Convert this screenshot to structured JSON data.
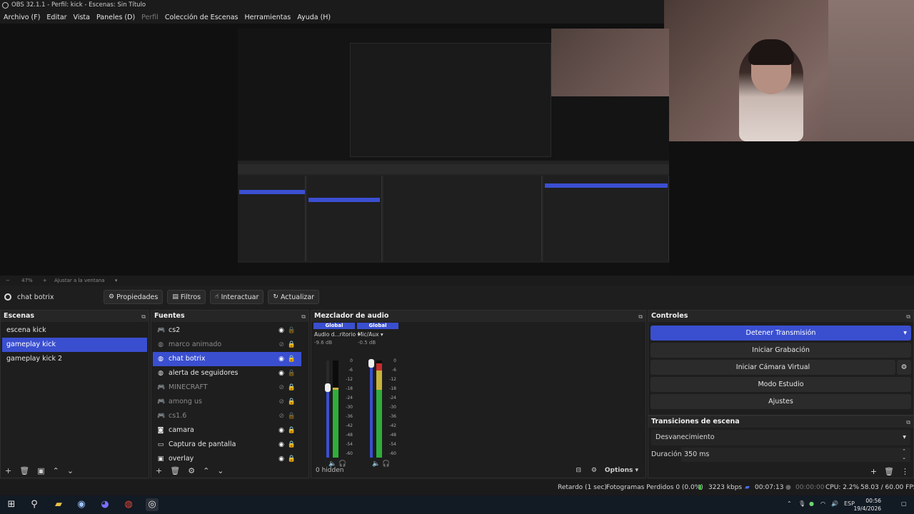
{
  "window": {
    "title": "OBS 32.1.1 - Perfil: kick - Escenas: Sin Título"
  },
  "menu": [
    {
      "label": "Archivo (F)",
      "enabled": true
    },
    {
      "label": "Editar",
      "enabled": true
    },
    {
      "label": "Vista",
      "enabled": true
    },
    {
      "label": "Paneles (D)",
      "enabled": true
    },
    {
      "label": "Perfil",
      "enabled": false
    },
    {
      "label": "Colección de Escenas",
      "enabled": true
    },
    {
      "label": "Herramientas",
      "enabled": true
    },
    {
      "label": "Ayuda (H)",
      "enabled": true
    }
  ],
  "zoom": {
    "percent": "47%",
    "fit_label": "Ajustar a la ventana"
  },
  "source_toolbar": {
    "current_source": "chat botrix",
    "properties": "Propiedades",
    "filters": "Filtros",
    "interact": "Interactuar",
    "refresh": "Actualizar"
  },
  "scenes": {
    "title": "Escenas",
    "items": [
      {
        "label": "escena kick",
        "selected": false
      },
      {
        "label": "gameplay kick",
        "selected": true
      },
      {
        "label": "gameplay kick 2",
        "selected": false
      }
    ]
  },
  "sources": {
    "title": "Fuentes",
    "items": [
      {
        "label": "cs2",
        "icon": "gamepad-icon",
        "visible": true,
        "locked": false,
        "selected": false
      },
      {
        "label": "marco animado",
        "icon": "globe-icon",
        "visible": false,
        "locked": true,
        "selected": false
      },
      {
        "label": "chat botrix",
        "icon": "globe-icon",
        "visible": true,
        "locked": true,
        "selected": true
      },
      {
        "label": "alerta de seguidores",
        "icon": "globe-icon",
        "visible": true,
        "locked": false,
        "selected": false
      },
      {
        "label": "MINECRAFT",
        "icon": "gamepad-icon",
        "visible": false,
        "locked": true,
        "selected": false
      },
      {
        "label": "among us",
        "icon": "gamepad-icon",
        "visible": false,
        "locked": true,
        "selected": false
      },
      {
        "label": "cs1.6",
        "icon": "gamepad-icon",
        "visible": false,
        "locked": false,
        "selected": false
      },
      {
        "label": "camara",
        "icon": "camera-icon",
        "visible": true,
        "locked": true,
        "selected": false
      },
      {
        "label": "Captura de pantalla",
        "icon": "monitor-icon",
        "visible": true,
        "locked": true,
        "selected": false
      },
      {
        "label": "overlay",
        "icon": "image-icon",
        "visible": true,
        "locked": true,
        "selected": false
      }
    ]
  },
  "mixer": {
    "title": "Mezclador de audio",
    "channels": [
      {
        "tag": "Global",
        "name": "Audio d...ritorio",
        "db": "-9.6 dB",
        "level": 0.72,
        "fader": 0.72
      },
      {
        "tag": "Global",
        "name": "Mic/Aux",
        "db": "-0.5 dB",
        "level": 0.97,
        "fader": 0.97
      }
    ],
    "scale": [
      "0",
      "-6",
      "-12",
      "-18",
      "-24",
      "-30",
      "-36",
      "-42",
      "-48",
      "-54",
      "-60"
    ],
    "hidden": "0 hidden",
    "options": "Options",
    "colors": {
      "green": "#2fae3a",
      "yellow": "#c9b23a",
      "red": "#c62b2b",
      "blue": "#3a4fd0"
    }
  },
  "controls": {
    "title": "Controles",
    "stop_stream": "Detener Transmisión",
    "start_recording": "Iniciar Grabación",
    "start_vcam": "Iniciar Cámara Virtual",
    "studio_mode": "Modo Estudio",
    "settings": "Ajustes"
  },
  "transitions": {
    "title": "Transiciones de escena",
    "selected": "Desvanecimiento",
    "duration_label": "Duración",
    "duration_value": "350 ms"
  },
  "status": {
    "delay": "Retardo (1 sec)",
    "dropped": "Fotogramas Perdidos 0 (0.0%)",
    "bitrate": "3223 kbps",
    "stream_time": "00:07:13",
    "rec_time": "00:00:00",
    "cpu": "CPU: 2.2%",
    "fps": "58.03 / 60.00 FPS"
  },
  "taskbar": {
    "lang": "ESP",
    "time": "00:56",
    "date": "19/4/2026"
  }
}
